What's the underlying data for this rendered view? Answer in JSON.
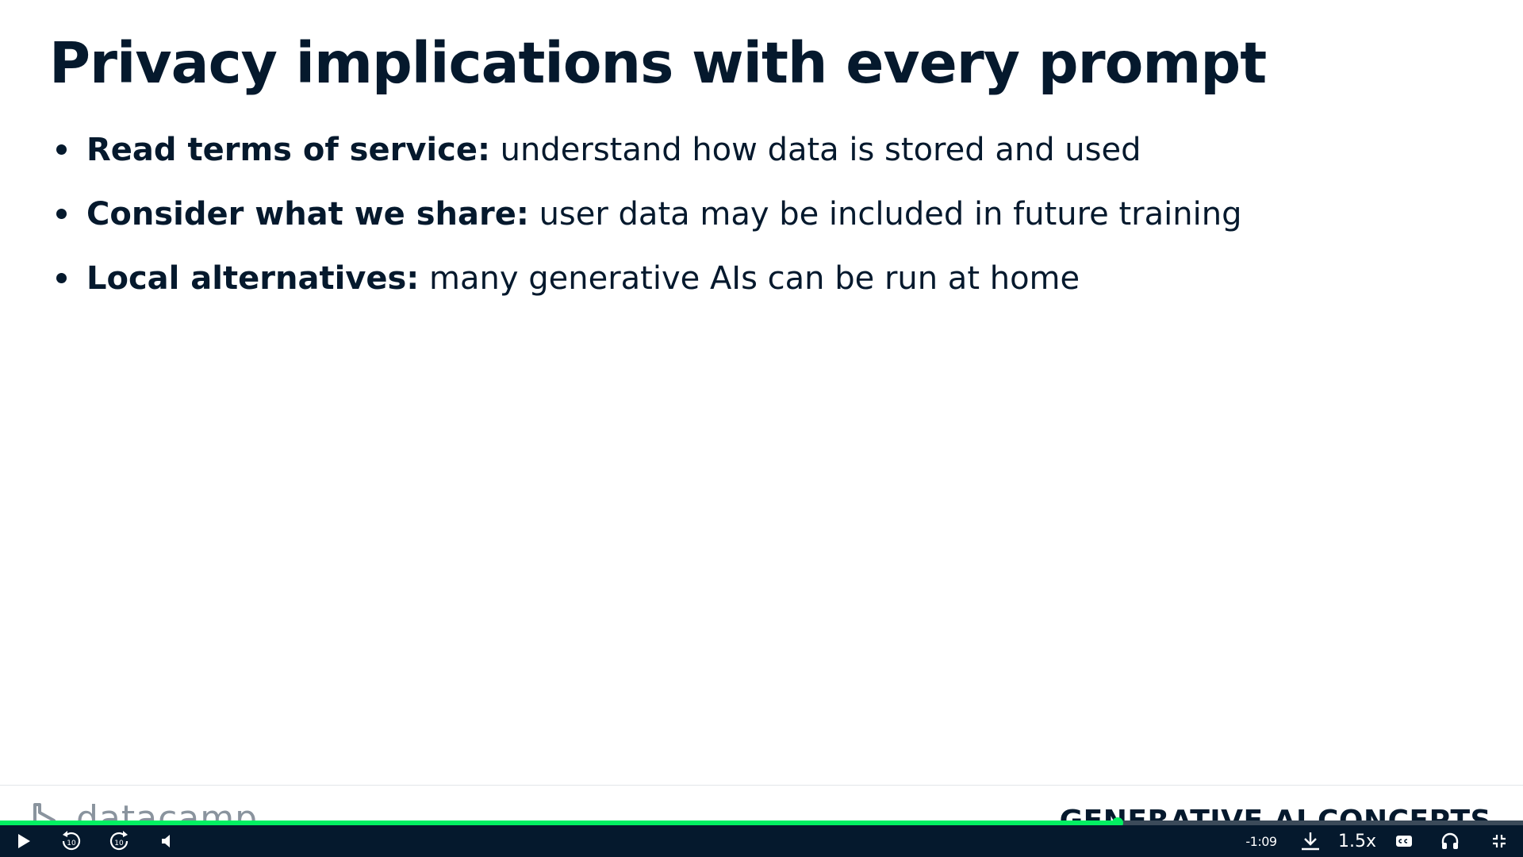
{
  "slide": {
    "title": "Privacy implications with every prompt",
    "bullets": [
      {
        "key": "Read terms of service:",
        "text": " understand how data is stored and used"
      },
      {
        "key": "Consider what we share:",
        "text": " user data may be included in future training"
      },
      {
        "key": "Local alternatives:",
        "text": " many generative AIs can be run at home"
      }
    ]
  },
  "footer": {
    "brand_name": "datacamp",
    "course_title": "GENERATIVE AI CONCEPTS"
  },
  "player": {
    "progress_fraction": 0.734,
    "time_remaining": "-1:09",
    "speed": "1.5x",
    "skip_back_label": "10",
    "skip_forward_label": "10",
    "icons": [
      "play-icon",
      "rewind-10-icon",
      "forward-10-icon",
      "volume-icon",
      "download-icon",
      "captions-icon",
      "headphones-icon",
      "exit-fullscreen-icon"
    ]
  },
  "colors": {
    "text": "#05192d",
    "accent_green": "#03ef62",
    "control_bar": "#05192d",
    "brand_grey": "#8a949e"
  }
}
